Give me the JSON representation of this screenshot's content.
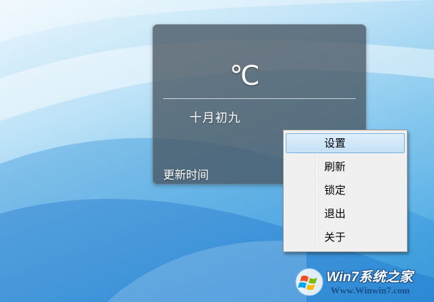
{
  "widget": {
    "temperature_unit": "℃",
    "lunar_date": "十月初九",
    "update_time_label": "更新时间"
  },
  "context_menu": {
    "items": [
      {
        "label": "设置",
        "highlighted": true
      },
      {
        "label": "刷新",
        "highlighted": false
      },
      {
        "label": "锁定",
        "highlighted": false
      },
      {
        "label": "退出",
        "highlighted": false
      },
      {
        "label": "关于",
        "highlighted": false
      }
    ]
  },
  "watermark": {
    "title": "Win7系统之家",
    "url": "Www.Winwin7.com",
    "logo_icon": "windows-logo-icon"
  },
  "colors": {
    "widget_background": "#485662",
    "menu_background": "#f0f0f0",
    "menu_highlight": "#c6e1f6",
    "menu_highlight_border": "#7ab5e2",
    "watermark_blue": "#1a4f8a"
  }
}
